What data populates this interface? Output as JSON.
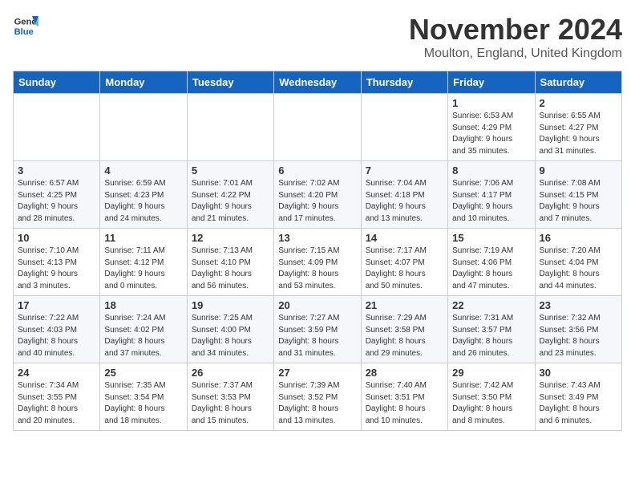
{
  "header": {
    "logo_line1": "General",
    "logo_line2": "Blue",
    "month_title": "November 2024",
    "location": "Moulton, England, United Kingdom"
  },
  "days_of_week": [
    "Sunday",
    "Monday",
    "Tuesday",
    "Wednesday",
    "Thursday",
    "Friday",
    "Saturday"
  ],
  "weeks": [
    [
      {
        "day": "",
        "info": ""
      },
      {
        "day": "",
        "info": ""
      },
      {
        "day": "",
        "info": ""
      },
      {
        "day": "",
        "info": ""
      },
      {
        "day": "",
        "info": ""
      },
      {
        "day": "1",
        "info": "Sunrise: 6:53 AM\nSunset: 4:29 PM\nDaylight: 9 hours\nand 35 minutes."
      },
      {
        "day": "2",
        "info": "Sunrise: 6:55 AM\nSunset: 4:27 PM\nDaylight: 9 hours\nand 31 minutes."
      }
    ],
    [
      {
        "day": "3",
        "info": "Sunrise: 6:57 AM\nSunset: 4:25 PM\nDaylight: 9 hours\nand 28 minutes."
      },
      {
        "day": "4",
        "info": "Sunrise: 6:59 AM\nSunset: 4:23 PM\nDaylight: 9 hours\nand 24 minutes."
      },
      {
        "day": "5",
        "info": "Sunrise: 7:01 AM\nSunset: 4:22 PM\nDaylight: 9 hours\nand 21 minutes."
      },
      {
        "day": "6",
        "info": "Sunrise: 7:02 AM\nSunset: 4:20 PM\nDaylight: 9 hours\nand 17 minutes."
      },
      {
        "day": "7",
        "info": "Sunrise: 7:04 AM\nSunset: 4:18 PM\nDaylight: 9 hours\nand 13 minutes."
      },
      {
        "day": "8",
        "info": "Sunrise: 7:06 AM\nSunset: 4:17 PM\nDaylight: 9 hours\nand 10 minutes."
      },
      {
        "day": "9",
        "info": "Sunrise: 7:08 AM\nSunset: 4:15 PM\nDaylight: 9 hours\nand 7 minutes."
      }
    ],
    [
      {
        "day": "10",
        "info": "Sunrise: 7:10 AM\nSunset: 4:13 PM\nDaylight: 9 hours\nand 3 minutes."
      },
      {
        "day": "11",
        "info": "Sunrise: 7:11 AM\nSunset: 4:12 PM\nDaylight: 9 hours\nand 0 minutes."
      },
      {
        "day": "12",
        "info": "Sunrise: 7:13 AM\nSunset: 4:10 PM\nDaylight: 8 hours\nand 56 minutes."
      },
      {
        "day": "13",
        "info": "Sunrise: 7:15 AM\nSunset: 4:09 PM\nDaylight: 8 hours\nand 53 minutes."
      },
      {
        "day": "14",
        "info": "Sunrise: 7:17 AM\nSunset: 4:07 PM\nDaylight: 8 hours\nand 50 minutes."
      },
      {
        "day": "15",
        "info": "Sunrise: 7:19 AM\nSunset: 4:06 PM\nDaylight: 8 hours\nand 47 minutes."
      },
      {
        "day": "16",
        "info": "Sunrise: 7:20 AM\nSunset: 4:04 PM\nDaylight: 8 hours\nand 44 minutes."
      }
    ],
    [
      {
        "day": "17",
        "info": "Sunrise: 7:22 AM\nSunset: 4:03 PM\nDaylight: 8 hours\nand 40 minutes."
      },
      {
        "day": "18",
        "info": "Sunrise: 7:24 AM\nSunset: 4:02 PM\nDaylight: 8 hours\nand 37 minutes."
      },
      {
        "day": "19",
        "info": "Sunrise: 7:25 AM\nSunset: 4:00 PM\nDaylight: 8 hours\nand 34 minutes."
      },
      {
        "day": "20",
        "info": "Sunrise: 7:27 AM\nSunset: 3:59 PM\nDaylight: 8 hours\nand 31 minutes."
      },
      {
        "day": "21",
        "info": "Sunrise: 7:29 AM\nSunset: 3:58 PM\nDaylight: 8 hours\nand 29 minutes."
      },
      {
        "day": "22",
        "info": "Sunrise: 7:31 AM\nSunset: 3:57 PM\nDaylight: 8 hours\nand 26 minutes."
      },
      {
        "day": "23",
        "info": "Sunrise: 7:32 AM\nSunset: 3:56 PM\nDaylight: 8 hours\nand 23 minutes."
      }
    ],
    [
      {
        "day": "24",
        "info": "Sunrise: 7:34 AM\nSunset: 3:55 PM\nDaylight: 8 hours\nand 20 minutes."
      },
      {
        "day": "25",
        "info": "Sunrise: 7:35 AM\nSunset: 3:54 PM\nDaylight: 8 hours\nand 18 minutes."
      },
      {
        "day": "26",
        "info": "Sunrise: 7:37 AM\nSunset: 3:53 PM\nDaylight: 8 hours\nand 15 minutes."
      },
      {
        "day": "27",
        "info": "Sunrise: 7:39 AM\nSunset: 3:52 PM\nDaylight: 8 hours\nand 13 minutes."
      },
      {
        "day": "28",
        "info": "Sunrise: 7:40 AM\nSunset: 3:51 PM\nDaylight: 8 hours\nand 10 minutes."
      },
      {
        "day": "29",
        "info": "Sunrise: 7:42 AM\nSunset: 3:50 PM\nDaylight: 8 hours\nand 8 minutes."
      },
      {
        "day": "30",
        "info": "Sunrise: 7:43 AM\nSunset: 3:49 PM\nDaylight: 8 hours\nand 6 minutes."
      }
    ]
  ]
}
